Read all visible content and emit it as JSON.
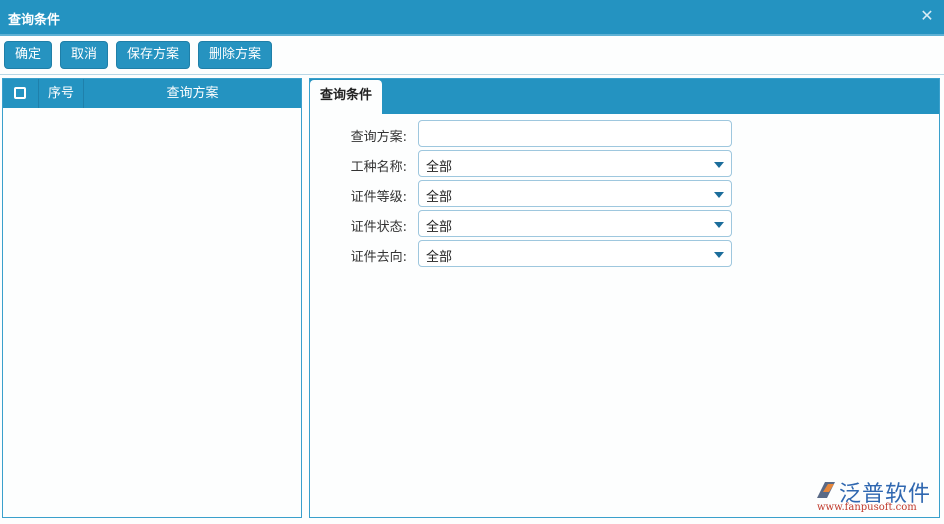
{
  "dialog": {
    "title": "查询条件",
    "close_icon": "close-icon"
  },
  "toolbar": {
    "confirm_label": "确定",
    "cancel_label": "取消",
    "save_scheme_label": "保存方案",
    "delete_scheme_label": "删除方案"
  },
  "scheme_grid": {
    "columns": [
      "序号",
      "查询方案"
    ],
    "rows": []
  },
  "conditions": {
    "tab_label": "查询条件",
    "fields": [
      {
        "label": "查询方案:",
        "type": "text",
        "value": ""
      },
      {
        "label": "工种名称:",
        "type": "select",
        "value": "全部"
      },
      {
        "label": "证件等级:",
        "type": "select",
        "value": "全部"
      },
      {
        "label": "证件状态:",
        "type": "select",
        "value": "全部"
      },
      {
        "label": "证件去向:",
        "type": "select",
        "value": "全部"
      }
    ]
  },
  "watermark": {
    "brand": "泛普软件",
    "url": "www.fanpusoft.com"
  },
  "colors": {
    "primary": "#2493c1",
    "border": "#3aa0cc",
    "arrow": "#1b6d9b"
  }
}
